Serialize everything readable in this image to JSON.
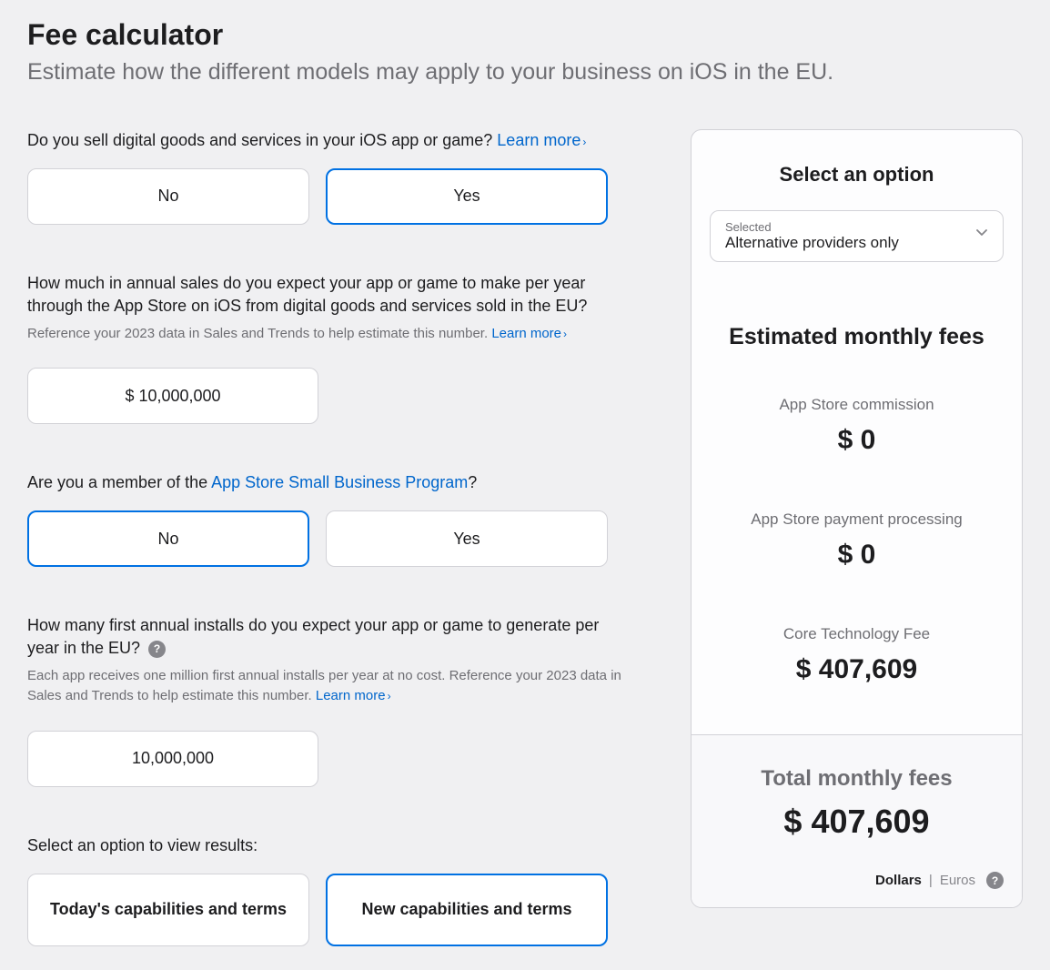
{
  "header": {
    "title": "Fee calculator",
    "subtitle": "Estimate how the different models may apply to your business on iOS in the EU."
  },
  "q1": {
    "text": "Do you sell digital goods and services in your iOS app or game?",
    "learn_more": "Learn more",
    "options": {
      "no": "No",
      "yes": "Yes"
    },
    "selected": "yes"
  },
  "q2": {
    "text": "How much in annual sales do you expect your app or game to make per year through the App Store on iOS from digital goods and services sold in the EU?",
    "helper": "Reference your 2023 data in Sales and Trends to help estimate this number.",
    "learn_more": "Learn more",
    "value": "$ 10,000,000"
  },
  "q3": {
    "prefix": "Are you a member of the ",
    "link": "App Store Small Business Program",
    "suffix": "?",
    "options": {
      "no": "No",
      "yes": "Yes"
    },
    "selected": "no"
  },
  "q4": {
    "text": "How many first annual installs do you expect your app or game to generate per year in the EU?",
    "helper": "Each app receives one million first annual installs per year at no cost. Reference your 2023 data in Sales and Trends to help estimate this number.",
    "learn_more": "Learn more",
    "value": "10,000,000"
  },
  "q5": {
    "text": "Select an option to view results:",
    "options": {
      "today": "Today's capabilities and terms",
      "new": "New capabilities and terms"
    },
    "selected": "new"
  },
  "panel": {
    "select_title": "Select an option",
    "dropdown": {
      "label": "Selected",
      "value": "Alternative providers only"
    },
    "estimated_title": "Estimated monthly fees",
    "fees": {
      "commission": {
        "label": "App Store commission",
        "value": "$ 0"
      },
      "processing": {
        "label": "App Store payment processing",
        "value": "$ 0"
      },
      "ctf": {
        "label": "Core Technology Fee",
        "value": "$ 407,609"
      }
    },
    "total": {
      "label": "Total monthly fees",
      "value": "$ 407,609"
    },
    "currency": {
      "dollars": "Dollars",
      "euros": "Euros",
      "selected": "dollars"
    }
  }
}
